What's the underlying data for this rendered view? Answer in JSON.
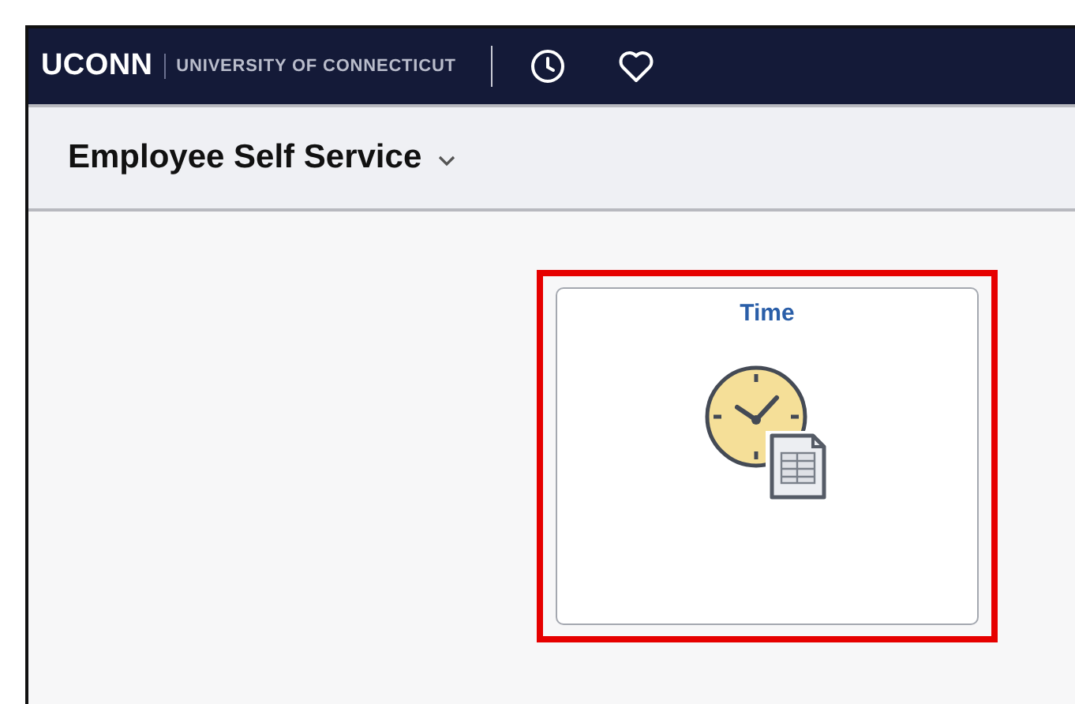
{
  "banner": {
    "logo": "UCONN",
    "subtitle": "UNIVERSITY OF CONNECTICUT"
  },
  "page_header": {
    "title": "Employee Self Service"
  },
  "tiles": [
    {
      "title": "Time",
      "highlighted": true
    }
  ]
}
